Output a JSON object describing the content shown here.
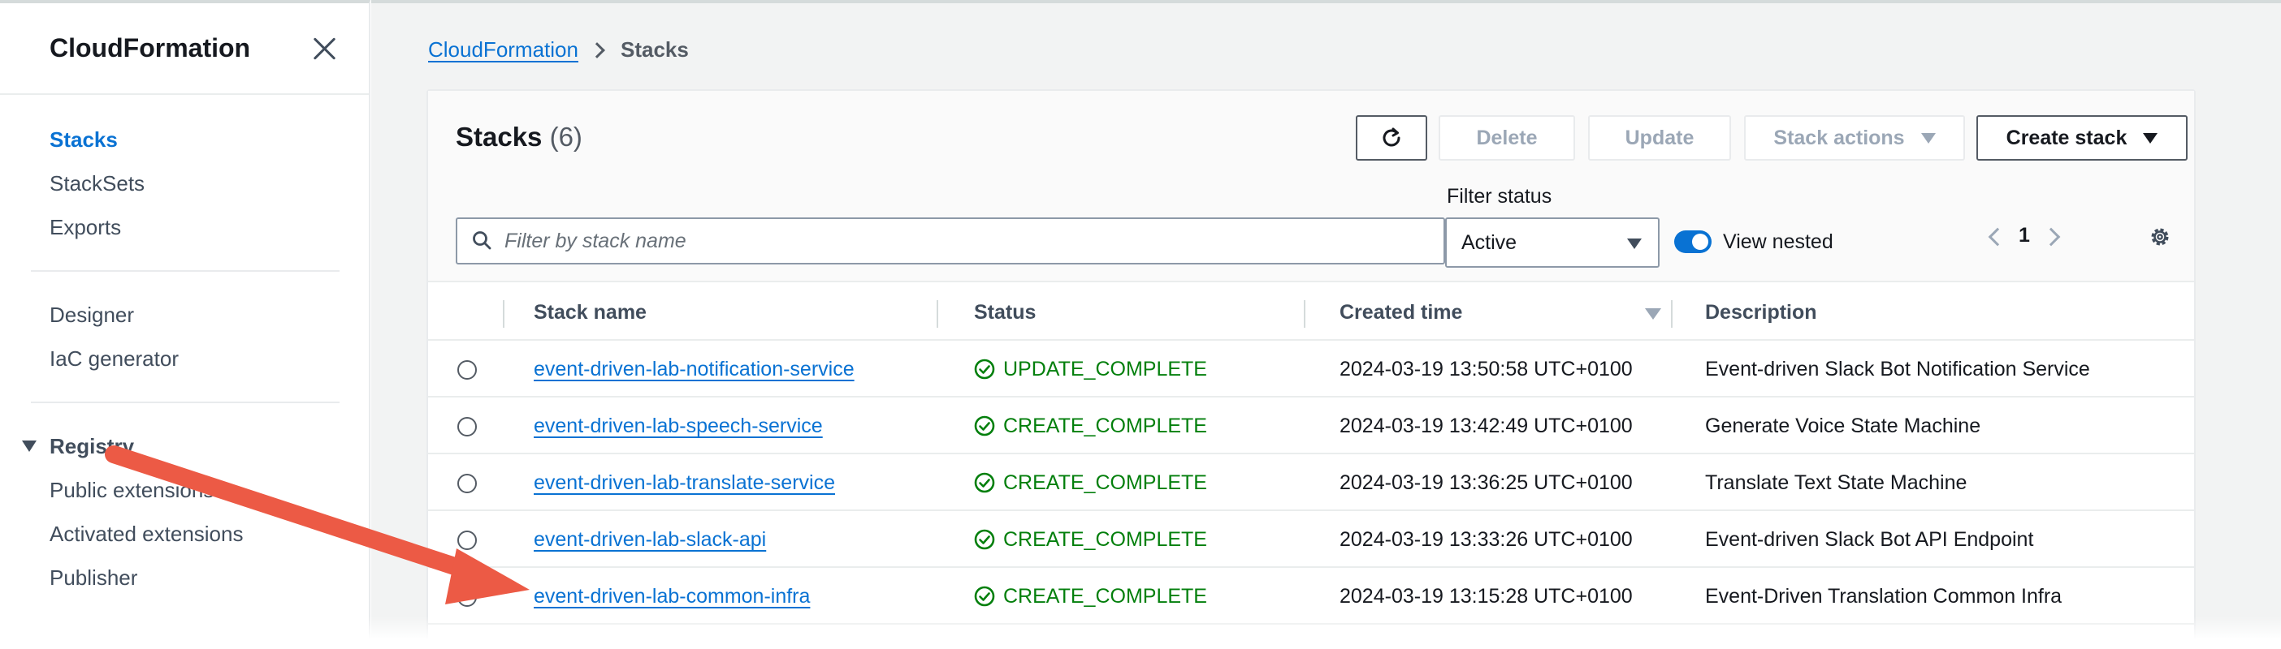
{
  "sidebar": {
    "title": "CloudFormation",
    "nav_primary": [
      "Stacks",
      "StackSets",
      "Exports"
    ],
    "nav_secondary": [
      "Designer",
      "IaC generator"
    ],
    "registry": {
      "label": "Registry",
      "items": [
        "Public extensions",
        "Activated extensions",
        "Publisher"
      ]
    }
  },
  "breadcrumb": {
    "root": "CloudFormation",
    "current": "Stacks"
  },
  "panel": {
    "title": "Stacks",
    "count": "(6)",
    "buttons": {
      "delete": "Delete",
      "update": "Update",
      "stack_actions": "Stack actions",
      "create_stack": "Create stack"
    },
    "search": {
      "placeholder": "Filter by stack name"
    },
    "filter": {
      "label": "Filter status",
      "value": "Active"
    },
    "view_nested": {
      "label": "View nested",
      "enabled": true
    },
    "page": "1"
  },
  "table": {
    "columns": [
      "Stack name",
      "Status",
      "Created time",
      "Description"
    ],
    "rows": [
      {
        "name": "event-driven-lab-notification-service",
        "status": "UPDATE_COMPLETE",
        "created": "2024-03-19 13:50:58 UTC+0100",
        "description": "Event-driven Slack Bot Notification Service"
      },
      {
        "name": "event-driven-lab-speech-service",
        "status": "CREATE_COMPLETE",
        "created": "2024-03-19 13:42:49 UTC+0100",
        "description": "Generate Voice State Machine"
      },
      {
        "name": "event-driven-lab-translate-service",
        "status": "CREATE_COMPLETE",
        "created": "2024-03-19 13:36:25 UTC+0100",
        "description": "Translate Text State Machine"
      },
      {
        "name": "event-driven-lab-slack-api",
        "status": "CREATE_COMPLETE",
        "created": "2024-03-19 13:33:26 UTC+0100",
        "description": "Event-driven Slack Bot API Endpoint"
      },
      {
        "name": "event-driven-lab-common-infra",
        "status": "CREATE_COMPLETE",
        "created": "2024-03-19 13:15:28 UTC+0100",
        "description": "Event-Driven Translation Common Infra"
      }
    ]
  },
  "colors": {
    "link": "#0972d3",
    "success": "#037f0c",
    "annotation_arrow": "#ec5a45"
  }
}
